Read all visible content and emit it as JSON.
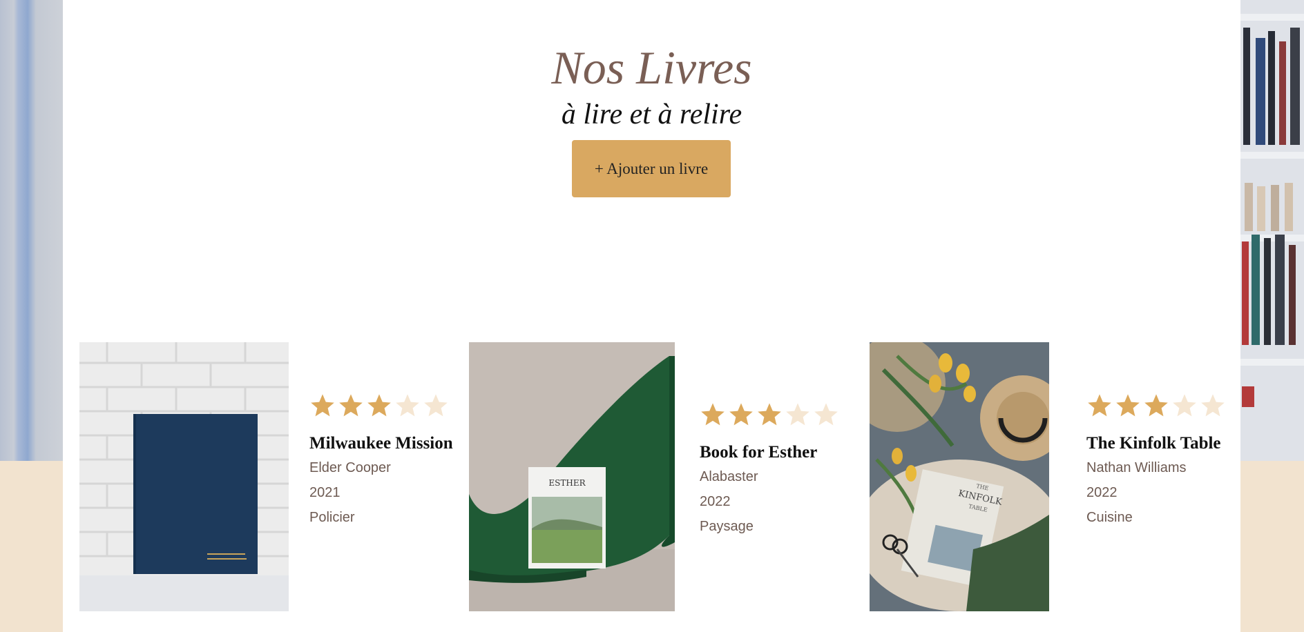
{
  "hero": {
    "title": "Nos Livres",
    "subtitle": "à lire et à relire",
    "add_button_label": "+ Ajouter un livre"
  },
  "colors": {
    "accent": "#d9a861",
    "title": "#7a5f55",
    "star_filled": "#dca95c",
    "star_empty": "#f5e6d2",
    "band": "#f2e3cf"
  },
  "books": [
    {
      "title": "Milwaukee Mission",
      "author": "Elder Cooper",
      "year": "2021",
      "genre": "Policier",
      "rating": 3,
      "max_rating": 5
    },
    {
      "title": "Book for Esther",
      "author": "Alabaster",
      "year": "2022",
      "genre": "Paysage",
      "rating": 3,
      "max_rating": 5
    },
    {
      "title": "The Kinfolk Table",
      "author": "Nathan Williams",
      "year": "2022",
      "genre": "Cuisine",
      "rating": 3,
      "max_rating": 5
    }
  ],
  "cover_text": {
    "book2": "ESTHER",
    "book3_line1": "THE",
    "book3_line2": "KINFOLK",
    "book3_line3": "TABLE"
  }
}
